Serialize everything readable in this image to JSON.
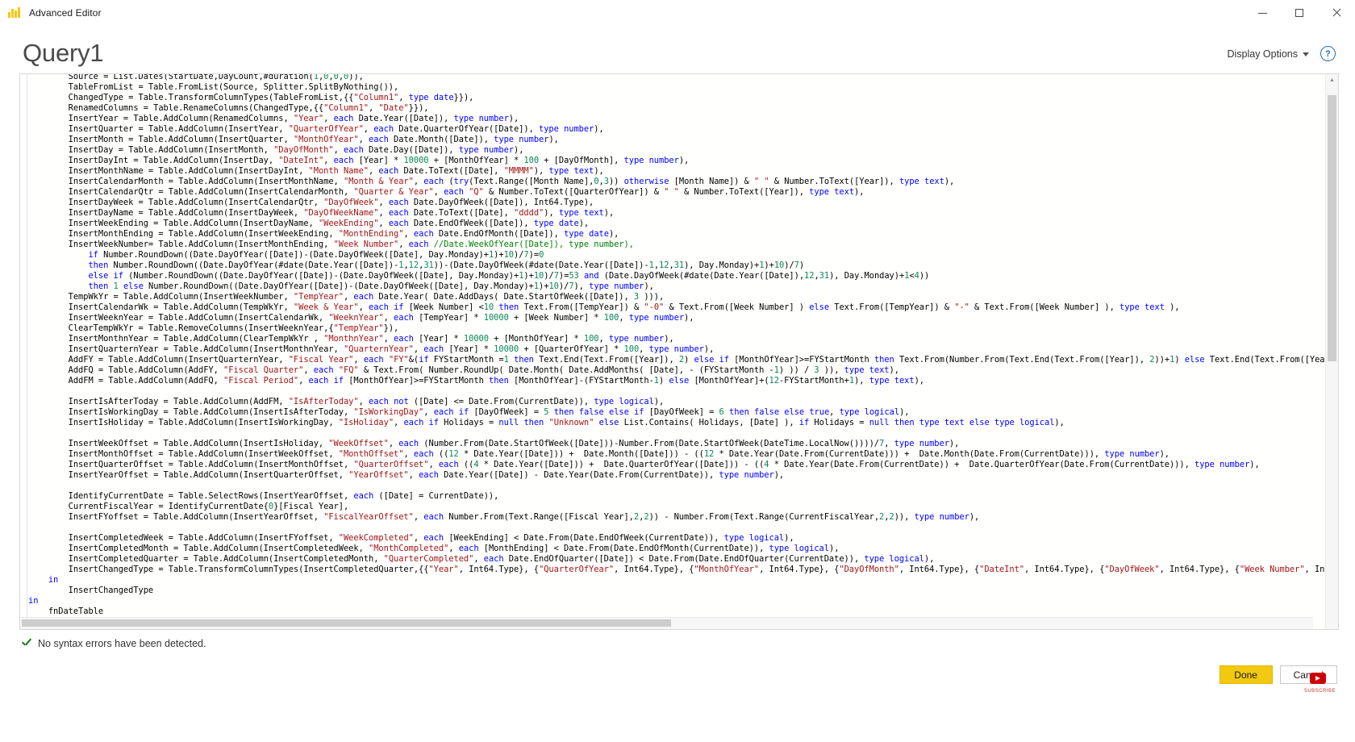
{
  "window": {
    "title": "Advanced Editor",
    "app_icon": "power-bi-icon",
    "minimize_label": "Minimize",
    "maximize_label": "Maximize",
    "close_label": "Close"
  },
  "header": {
    "page_title": "Query1",
    "display_options_label": "Display Options",
    "help_label": "?"
  },
  "status": {
    "icon": "checkmark-icon",
    "message": "No syntax errors have been detected."
  },
  "footer": {
    "done_label": "Done",
    "cancel_label": "Cancel"
  },
  "overlay": {
    "subscribe_label": "SUBSCRIBE"
  },
  "colors": {
    "accent": "#f2c811",
    "keyword": "#0000ff",
    "string": "#a31515",
    "number": "#098658",
    "comment": "#008000",
    "success": "#107c10",
    "title_text": "#4a4a4a"
  },
  "editor": {
    "language": "M",
    "scroll_vertical_visible": true,
    "scroll_horizontal_visible": true,
    "code": "        DayCount = Duration.Days(Duration.From(#EndDate - StartDate))+1,\n        Source = List.Dates(StartDate,DayCount,#duration(1,0,0,0)),\n        TableFromList = Table.FromList(Source, Splitter.SplitByNothing()),\n        ChangedType = Table.TransformColumnTypes(TableFromList,{{\"Column1\", type date}}),\n        RenamedColumns = Table.RenameColumns(ChangedType,{{\"Column1\", \"Date\"}}),\n        InsertYear = Table.AddColumn(RenamedColumns, \"Year\", each Date.Year([Date]), type number),\n        InsertQuarter = Table.AddColumn(InsertYear, \"QuarterOfYear\", each Date.QuarterOfYear([Date]), type number),\n        InsertMonth = Table.AddColumn(InsertQuarter, \"MonthOfYear\", each Date.Month([Date]), type number),\n        InsertDay = Table.AddColumn(InsertMonth, \"DayOfMonth\", each Date.Day([Date]), type number),\n        InsertDayInt = Table.AddColumn(InsertDay, \"DateInt\", each [Year] * 10000 + [MonthOfYear] * 100 + [DayOfMonth], type number),\n        InsertMonthName = Table.AddColumn(InsertDayInt, \"Month Name\", each Date.ToText([Date], \"MMMM\"), type text),\n        InsertCalendarMonth = Table.AddColumn(InsertMonthName, \"Month & Year\", each (try(Text.Range([Month Name],0,3)) otherwise [Month Name]) & \" \" & Number.ToText([Year]), type text),\n        InsertCalendarQtr = Table.AddColumn(InsertCalendarMonth, \"Quarter & Year\", each \"Q\" & Number.ToText([QuarterOfYear]) & \" \" & Number.ToText([Year]), type text),\n        InsertDayWeek = Table.AddColumn(InsertCalendarQtr, \"DayOfWeek\", each Date.DayOfWeek([Date]), Int64.Type),\n        InsertDayName = Table.AddColumn(InsertDayWeek, \"DayOfWeekName\", each Date.ToText([Date], \"dddd\"), type text),\n        InsertWeekEnding = Table.AddColumn(InsertDayName, \"WeekEnding\", each Date.EndOfWeek([Date]), type date),\n        InsertMonthEnding = Table.AddColumn(InsertWeekEnding, \"MonthEnding\", each Date.EndOfMonth([Date]), type date),\n        InsertWeekNumber= Table.AddColumn(InsertMonthEnding, \"Week Number\", each //Date.WeekOfYear([Date]), type number),\n            if Number.RoundDown((Date.DayOfYear([Date])-(Date.DayOfWeek([Date], Day.Monday)+1)+10)/7)=0\n            then Number.RoundDown((Date.DayOfYear(#date(Date.Year([Date])-1,12,31))-(Date.DayOfWeek(#date(Date.Year([Date])-1,12,31), Day.Monday)+1)+10)/7)\n            else if (Number.RoundDown((Date.DayOfYear([Date])-(Date.DayOfWeek([Date], Day.Monday)+1)+10)/7)=53 and (Date.DayOfWeek(#date(Date.Year([Date]),12,31), Day.Monday)+1<4))\n            then 1 else Number.RoundDown((Date.DayOfYear([Date])-(Date.DayOfWeek([Date], Day.Monday)+1)+10)/7), type number),\n        TempWkYr = Table.AddColumn(InsertWeekNumber, \"TempYear\", each Date.Year( Date.AddDays( Date.StartOfWeek([Date]), 3 ))),\n        InsertCalendarWk = Table.AddColumn(TempWkYr, \"Week & Year\", each if [Week Number] <10 then Text.From([TempYear]) & \"-0\" & Text.From([Week Number] ) else Text.From([TempYear]) & \"-\" & Text.From([Week Number] ), type text ),\n        InsertWeeknYear = Table.AddColumn(InsertCalendarWk, \"WeeknYear\", each [TempYear] * 10000 + [Week Number] * 100, type number),\n        ClearTempWkYr = Table.RemoveColumns(InsertWeeknYear,{\"TempYear\"}),\n        InsertMonthnYear = Table.AddColumn(ClearTempWkYr , \"MonthnYear\", each [Year] * 10000 + [MonthOfYear] * 100, type number),\n        InsertQuarternYear = Table.AddColumn(InsertMonthnYear, \"QuarternYear\", each [Year] * 10000 + [QuarterOfYear] * 100, type number),\n        AddFY = Table.AddColumn(InsertQuarternYear, \"Fiscal Year\", each \"FY\"&(if FYStartMonth =1 then Text.End(Text.From([Year]), 2) else if [MonthOfYear]>=FYStartMonth then Text.From(Number.From(Text.End(Text.From([Year]), 2))+1) else Text.End(Text.From([Year]), 2)), type text),\n        AddFQ = Table.AddColumn(AddFY, \"Fiscal Quarter\", each \"FQ\" & Text.From( Number.RoundUp( Date.Month( Date.AddMonths( [Date], - (FYStartMonth -1) )) / 3 )), type text),\n        AddFM = Table.AddColumn(AddFQ, \"Fiscal Period\", each if [MonthOfYear]>=FYStartMonth then [MonthOfYear]-(FYStartMonth-1) else [MonthOfYear]+(12-FYStartMonth+1), type text),\n\n        InsertIsAfterToday = Table.AddColumn(AddFM, \"IsAfterToday\", each not ([Date] <= Date.From(CurrentDate)), type logical),\n        InsertIsWorkingDay = Table.AddColumn(InsertIsAfterToday, \"IsWorkingDay\", each if [DayOfWeek] = 5 then false else if [DayOfWeek] = 6 then false else true, type logical),\n        InsertIsHoliday = Table.AddColumn(InsertIsWorkingDay, \"IsHoliday\", each if Holidays = null then \"Unknown\" else List.Contains( Holidays, [Date] ), if Holidays = null then type text else type logical),\n\n        InsertWeekOffset = Table.AddColumn(InsertIsHoliday, \"WeekOffset\", each (Number.From(Date.StartOfWeek([Date]))-Number.From(Date.StartOfWeek(DateTime.LocalNow())))/7, type number),\n        InsertMonthOffset = Table.AddColumn(InsertWeekOffset, \"MonthOffset\", each ((12 * Date.Year([Date])) +  Date.Month([Date])) - ((12 * Date.Year(Date.From(CurrentDate))) +  Date.Month(Date.From(CurrentDate))), type number),\n        InsertQuarterOffset = Table.AddColumn(InsertMonthOffset, \"QuarterOffset\", each ((4 * Date.Year([Date])) +  Date.QuarterOfYear([Date])) - ((4 * Date.Year(Date.From(CurrentDate)) +  Date.QuarterOfYear(Date.From(CurrentDate))), type number),\n        InsertYearOffset = Table.AddColumn(InsertQuarterOffset, \"YearOffset\", each Date.Year([Date]) - Date.Year(Date.From(CurrentDate)), type number),\n\n        IdentifyCurrentDate = Table.SelectRows(InsertYearOffset, each ([Date] = CurrentDate)),\n        CurrentFiscalYear = IdentifyCurrentDate{0}[Fiscal Year],\n        InsertFYoffset = Table.AddColumn(InsertYearOffset, \"FiscalYearOffset\", each Number.From(Text.Range([Fiscal Year],2,2)) - Number.From(Text.Range(CurrentFiscalYear,2,2)), type number),\n\n        InsertCompletedWeek = Table.AddColumn(InsertFYoffset, \"WeekCompleted\", each [WeekEnding] < Date.From(Date.EndOfWeek(CurrentDate)), type logical),\n        InsertCompletedMonth = Table.AddColumn(InsertCompletedWeek, \"MonthCompleted\", each [MonthEnding] < Date.From(Date.EndOfMonth(CurrentDate)), type logical),\n        InsertCompletedQuarter = Table.AddColumn(InsertCompletedMonth, \"QuarterCompleted\", each Date.EndOfQuarter([Date]) < Date.From(Date.EndOfQuarter(CurrentDate)), type logical),\n        InsertChangedType = Table.TransformColumnTypes(InsertCompletedQuarter,{{\"Year\", Int64.Type}, {\"QuarterOfYear\", Int64.Type}, {\"MonthOfYear\", Int64.Type}, {\"DayOfMonth\", Int64.Type}, {\"DateInt\", Int64.Type}, {\"DayOfWeek\", Int64.Type}, {\"Week Number\", Int64.Type}, {\"WeeknYear\", \n    in\n        InsertChangedType\nin\n    fnDateTable"
  }
}
